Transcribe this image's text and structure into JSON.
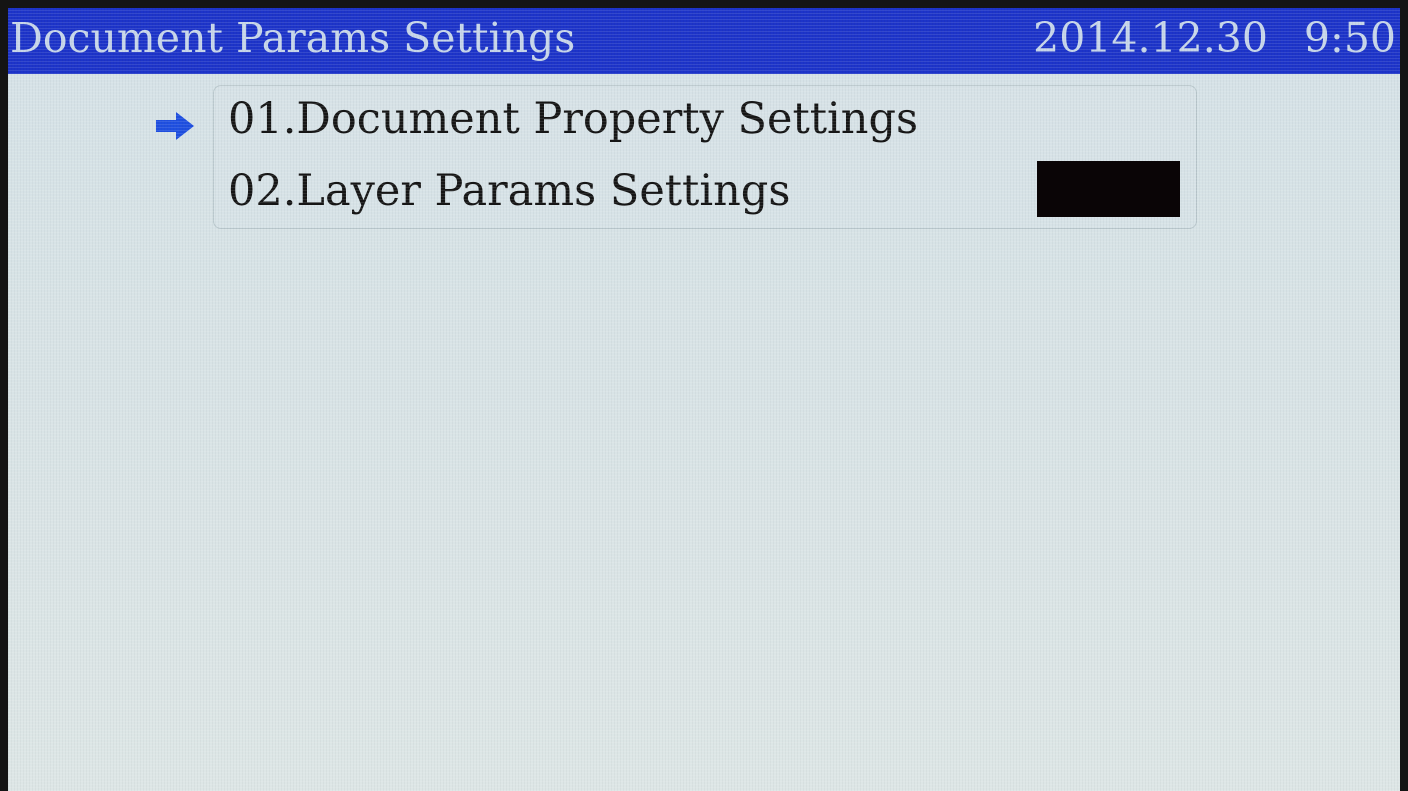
{
  "title_bar": {
    "title": "Document Params Settings",
    "date": "2014.12.30",
    "time": "9:50"
  },
  "menu": {
    "items": [
      {
        "label": "01.Document Property Settings",
        "selected": true
      },
      {
        "label": "02.Layer Params Settings",
        "selected": false
      }
    ],
    "selection_icon": "right-arrow-icon"
  },
  "colors": {
    "title_bar": "#1d34c9",
    "title_text": "#c7d6ea",
    "screen_bg": "#d8e3e6",
    "arrow": "#1f4fe0",
    "text": "#161616",
    "block": "#0a0506"
  }
}
